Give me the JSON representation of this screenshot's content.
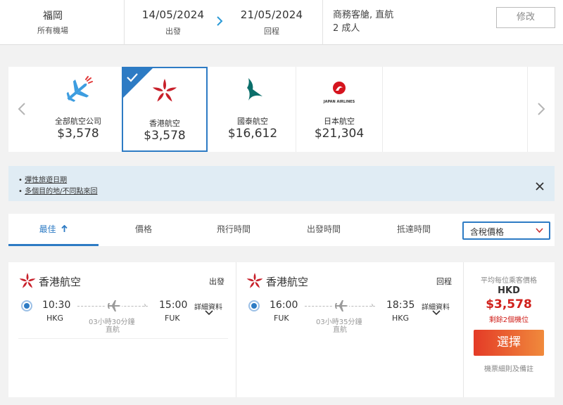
{
  "search": {
    "destination": "福岡",
    "destination_sub": "所有機場",
    "depart_date": "14/05/2024",
    "depart_label": "出發",
    "return_date": "21/05/2024",
    "return_label": "回程",
    "cabin": "商務客艙, 直航",
    "passengers": "2 成人",
    "edit_label": "修改",
    "arrow_icon": "chevron-right-icon"
  },
  "carousel": {
    "prev_icon": "chevron-left-icon",
    "next_icon": "chevron-right-icon",
    "cards": [
      {
        "name": "全部航空公司",
        "price": "$3,578",
        "icon": "all-airlines-plane-icon",
        "selected": false
      },
      {
        "name": "香港航空",
        "price": "$3,578",
        "icon": "hong-kong-airlines-logo",
        "selected": true
      },
      {
        "name": "國泰航空",
        "price": "$16,612",
        "icon": "cathay-pacific-logo",
        "selected": false
      },
      {
        "name": "日本航空",
        "price": "$21,304",
        "icon": "japan-airlines-logo",
        "selected": false
      }
    ],
    "jal_logo_text": "JAPAN AIRLINES"
  },
  "notice": {
    "bullet": "•",
    "items": [
      "彈性旅遊日期",
      "多個目的地/不同點來回"
    ],
    "close_icon": "close-icon"
  },
  "sort": {
    "tabs": [
      "最佳",
      "價格",
      "飛行時間",
      "出發時間",
      "抵達時間"
    ],
    "active_index": 0,
    "active_icon": "arrow-up-icon",
    "select_value": "含稅價格",
    "select_icon": "chevron-down-icon"
  },
  "result": {
    "outbound": {
      "airline": "香港航空",
      "direction": "出發",
      "dep_time": "10:30",
      "dep_airport": "HKG",
      "arr_time": "15:00",
      "arr_airport": "FUK",
      "duration": "03小時30分鐘",
      "stops": "直航",
      "details": "詳細資料"
    },
    "inbound": {
      "airline": "香港航空",
      "direction": "回程",
      "dep_time": "16:00",
      "dep_airport": "FUK",
      "arr_time": "18:35",
      "arr_airport": "HKG",
      "duration": "03小時35分鐘",
      "stops": "直航",
      "details": "詳細資料"
    },
    "price": {
      "avg_label": "平均每位乘客價格",
      "currency": "HKD",
      "amount": "$3,578",
      "seats_left": "剩餘2個機位",
      "select_label": "選擇",
      "terms": "機票細則及備註"
    }
  },
  "colors": {
    "accent": "#2d7bc4",
    "price_red": "#d0211c",
    "hk_airlines_red": "#c8202a",
    "cathay_green": "#0b6e6a",
    "jal_red": "#d5141e",
    "notice_bg": "#e0ecf4"
  }
}
